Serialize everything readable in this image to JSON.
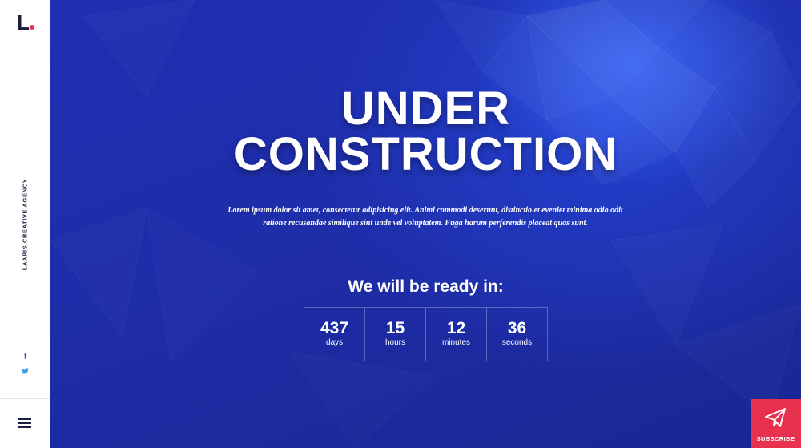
{
  "sidebar": {
    "logo_text": "L",
    "tagline": "LAARIS CREATIVE AGENCY",
    "social": {
      "facebook_glyph": "f",
      "twitter_glyph": "🐦"
    },
    "menu_icon": "hamburger-menu-icon"
  },
  "hero": {
    "title_line1": "UNDER",
    "title_line2": "CONSTRUCTION",
    "lead": "Lorem ipsum dolor sit amet, consectetur adipisicing elit. Animi commodi deserunt, distinctio et eveniet minima odio odit ratione recusandae similique sint unde vel voluptatem. Fuga harum perferendis placeat quos sunt."
  },
  "countdown": {
    "heading": "We will be ready in:",
    "units": [
      {
        "value": "437",
        "label": "days"
      },
      {
        "value": "15",
        "label": "hours"
      },
      {
        "value": "12",
        "label": "minutes"
      },
      {
        "value": "36",
        "label": "seconds"
      }
    ]
  },
  "subscribe": {
    "label": "SUBSCRIBE",
    "icon": "paper-plane-icon"
  },
  "colors": {
    "background_blue": "#1c2aa6",
    "accent_red": "#e8314f",
    "sidebar_bg": "#ffffff"
  }
}
